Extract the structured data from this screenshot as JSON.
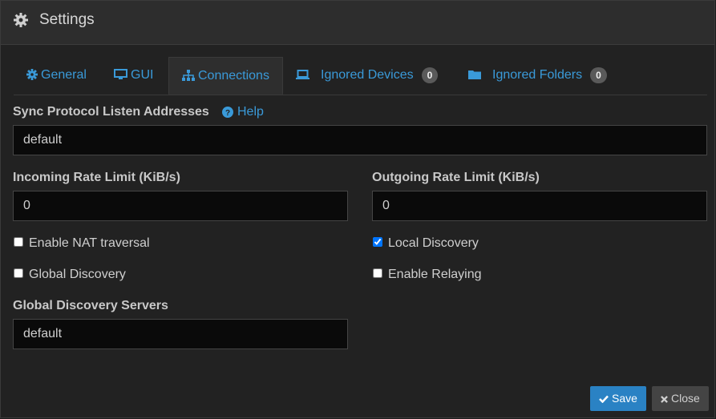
{
  "header": {
    "title": "Settings",
    "icon": "gear-icon"
  },
  "tabs": [
    {
      "label": "General",
      "icon": "gear-icon"
    },
    {
      "label": "GUI",
      "icon": "desktop-icon"
    },
    {
      "label": "Connections",
      "icon": "sitemap-icon",
      "active": true
    },
    {
      "label": "Ignored Devices",
      "icon": "laptop-icon",
      "badge": "0"
    },
    {
      "label": "Ignored Folders",
      "icon": "folder-icon",
      "badge": "0"
    }
  ],
  "form": {
    "listen_label": "Sync Protocol Listen Addresses",
    "help_label": "Help",
    "listen_value": "default",
    "incoming_label": "Incoming Rate Limit (KiB/s)",
    "incoming_value": "0",
    "outgoing_label": "Outgoing Rate Limit (KiB/s)",
    "outgoing_value": "0",
    "nat_label": "Enable NAT traversal",
    "nat_checked": false,
    "local_label": "Local Discovery",
    "local_checked": true,
    "global_label": "Global Discovery",
    "global_checked": false,
    "relay_label": "Enable Relaying",
    "relay_checked": false,
    "servers_label": "Global Discovery Servers",
    "servers_value": "default"
  },
  "footer": {
    "save_label": "Save",
    "close_label": "Close"
  },
  "colors": {
    "accent": "#3a9ad9",
    "save": "#2a82c4",
    "background": "#222222"
  }
}
